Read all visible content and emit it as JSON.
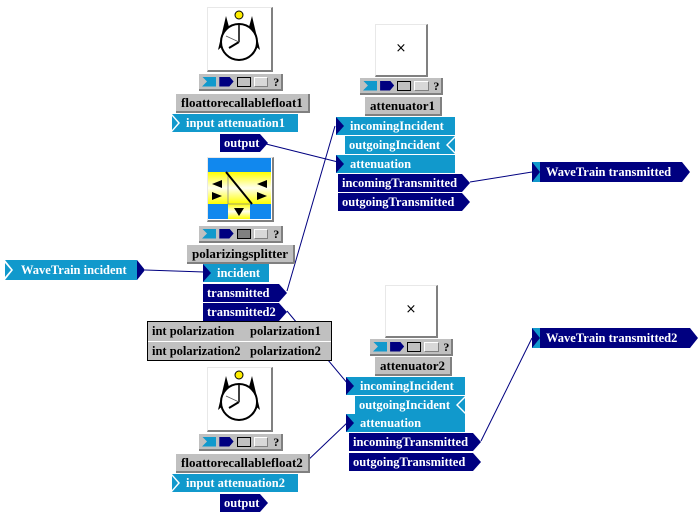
{
  "colors": {
    "inport": "#1199cc",
    "outport": "#000080",
    "label_bg": "#c0c0c0",
    "wire": "#000080"
  },
  "toolbar_icons": [
    "input-port-icon",
    "output-port-icon",
    "box-icon",
    "button-icon",
    "help-icon"
  ],
  "toolbar_help": "?",
  "blocks": {
    "float1": {
      "icon": "stopwatch-icon",
      "label": "floattorecallablefloat1",
      "ports": {
        "input": "input attenuation1",
        "output": "output"
      }
    },
    "splitter": {
      "icon": "polarizing-splitter-icon",
      "label": "polarizingsplitter",
      "ports": {
        "incident": "incident",
        "transmitted": "transmitted",
        "transmitted2": "transmitted2"
      },
      "params": [
        {
          "name": "int polarization",
          "value": "polarization1"
        },
        {
          "name": "int polarization2",
          "value": "polarization2"
        }
      ]
    },
    "float2": {
      "icon": "stopwatch-icon",
      "label": "floattorecallablefloat2",
      "ports": {
        "input": "input attenuation2",
        "output": "output"
      }
    },
    "att1": {
      "icon": "x-mark",
      "icon_text": "×",
      "label": "attenuator1",
      "ports": {
        "incomingIncident": "incomingIncident",
        "outgoingIncident": "outgoingIncident",
        "attenuation": "attenuation",
        "incomingTransmitted": "incomingTransmitted",
        "outgoingTransmitted": "outgoingTransmitted"
      }
    },
    "att2": {
      "icon": "x-mark",
      "icon_text": "×",
      "label": "attenuator2",
      "ports": {
        "incomingIncident": "incomingIncident",
        "outgoingIncident": "outgoingIncident",
        "attenuation": "attenuation",
        "incomingTransmitted": "incomingTransmitted",
        "outgoingTransmitted": "outgoingTransmitted"
      }
    }
  },
  "external": {
    "incident": "WaveTrain incident",
    "transmitted": "WaveTrain transmitted",
    "transmitted2": "WaveTrain transmitted2"
  }
}
